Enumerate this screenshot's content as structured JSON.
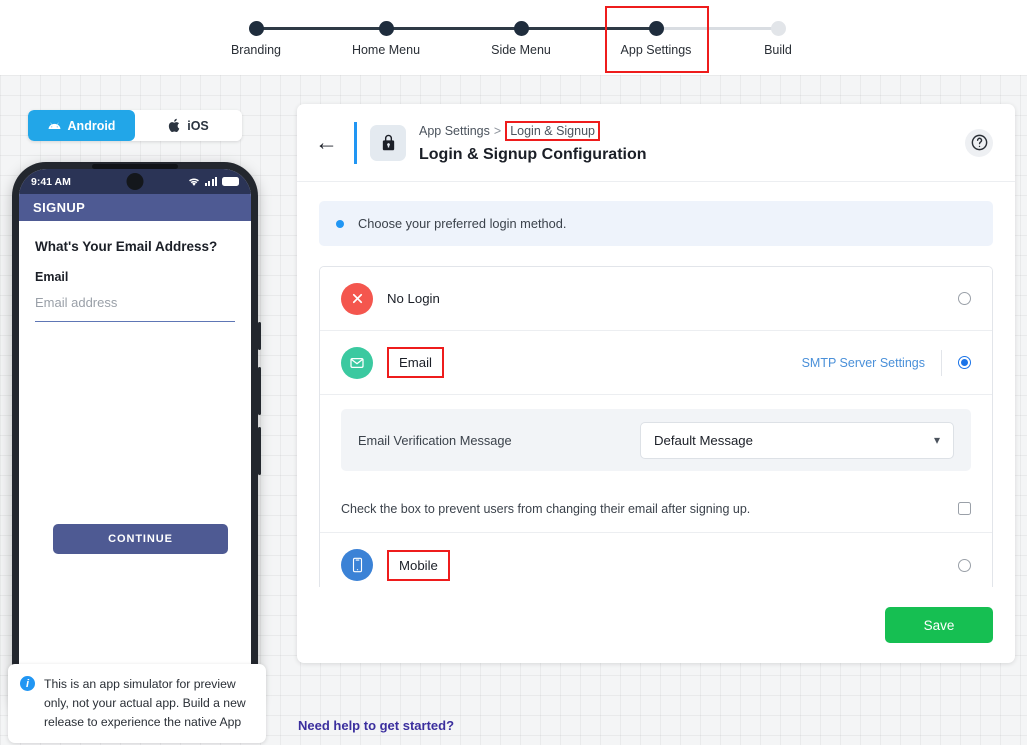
{
  "stepper": {
    "steps": [
      {
        "label": "Branding",
        "state": "done"
      },
      {
        "label": "Home Menu",
        "state": "done"
      },
      {
        "label": "Side Menu",
        "state": "done"
      },
      {
        "label": "App Settings",
        "state": "current"
      },
      {
        "label": "Build",
        "state": "inactive"
      }
    ],
    "highlight_color": "#ee1c1c"
  },
  "preview": {
    "tabs": [
      {
        "label": "Android",
        "icon": "android-icon",
        "active": true
      },
      {
        "label": "iOS",
        "icon": "apple-icon",
        "active": false
      }
    ],
    "phone": {
      "status_time": "9:41 AM",
      "app_bar_title": "SIGNUP",
      "question": "What's Your Email Address?",
      "field_label": "Email",
      "field_placeholder": "Email address",
      "field_value": "",
      "continue_label": "CONTINUE",
      "status_bar_color": "#2b3456",
      "app_bar_color": "#4e5a93",
      "button_color": "#4e5a93"
    },
    "note": "This is an app simulator for preview only, not your actual app. Build a new release to experience the native App"
  },
  "card": {
    "breadcrumb": {
      "parent": "App Settings",
      "separator": ">",
      "current": "Login & Signup"
    },
    "title": "Login & Signup Configuration",
    "banner": "Choose your preferred login method.",
    "options": [
      {
        "label": "No Login",
        "icon": "close-circle-icon",
        "icon_color": "#f4564e",
        "selected": false,
        "highlighted": false
      },
      {
        "label": "Email",
        "icon": "envelope-icon",
        "icon_color": "#3bc9a0",
        "selected": true,
        "highlighted": true,
        "link_label": "SMTP Server Settings"
      },
      {
        "label": "Mobile",
        "icon": "mobile-phone-icon",
        "icon_color": "#3b82d6",
        "selected": false,
        "highlighted": true
      }
    ],
    "email_settings": {
      "verification_label": "Email Verification Message",
      "verification_value": "Default Message",
      "prevent_change_label": "Check the box to prevent users from changing their email after signing up.",
      "prevent_change_checked": false
    },
    "save_label": "Save",
    "save_color": "#16bf52"
  },
  "footer": {
    "help_link": "Need help to get started?"
  }
}
